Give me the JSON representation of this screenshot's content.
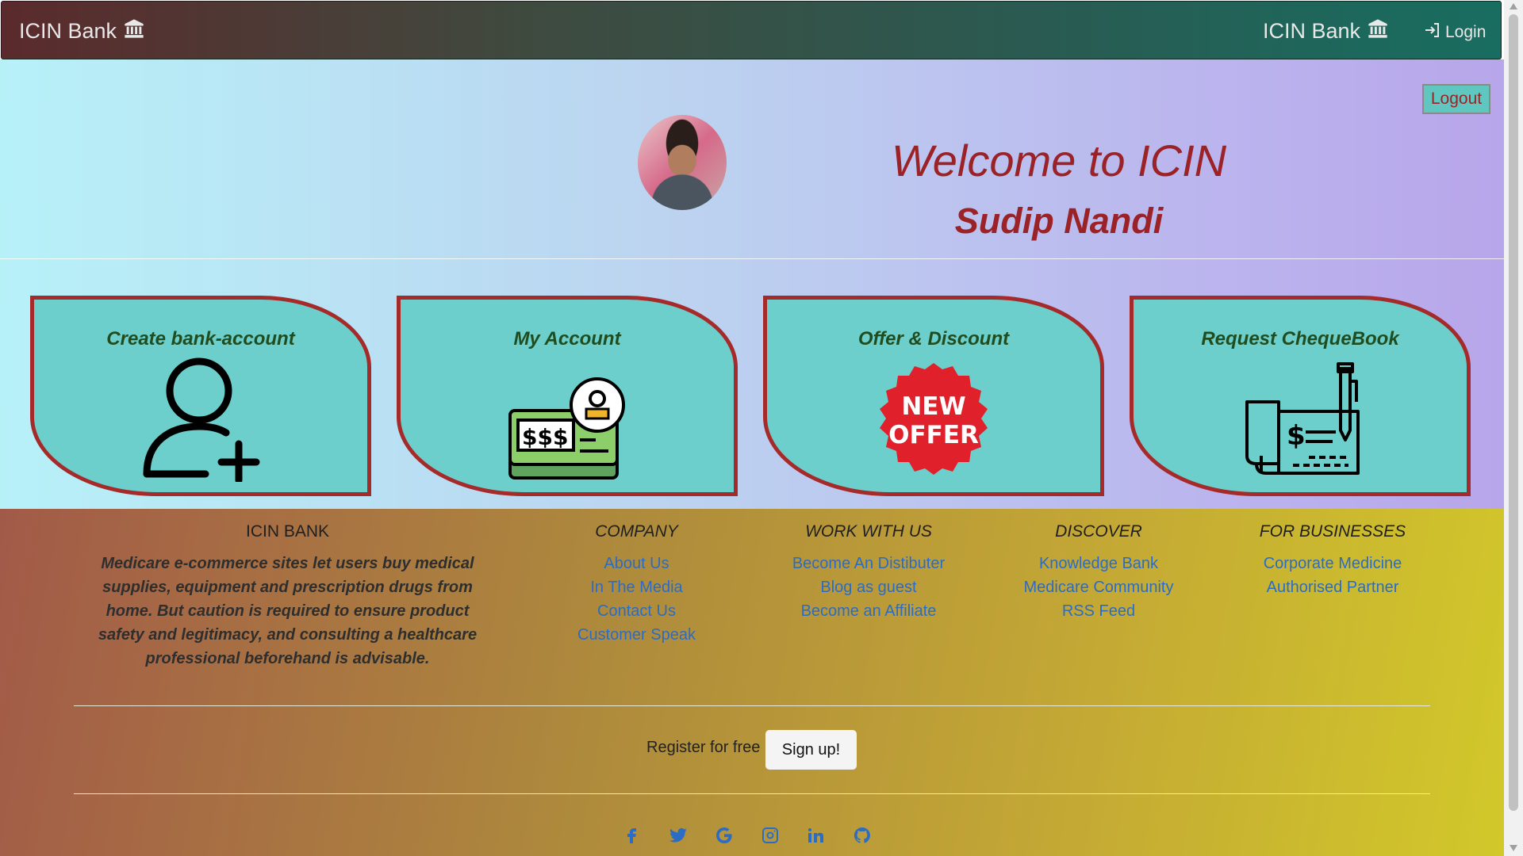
{
  "navbar": {
    "brand_left": "ICIN Bank",
    "brand_right": "ICIN Bank",
    "login_label": "Login"
  },
  "hero": {
    "logout_label": "Logout",
    "welcome": "Welcome to ICIN",
    "user_name": "Sudip Nandi"
  },
  "cards": [
    {
      "title": "Create bank-account",
      "icon": "add-user-icon"
    },
    {
      "title": "My Account",
      "icon": "account-cheque-icon"
    },
    {
      "title": "Offer & Discount",
      "icon": "new-offer-badge-icon",
      "badge_line1": "NEW",
      "badge_line2": "OFFER"
    },
    {
      "title": "Request ChequeBook",
      "icon": "chequebook-pen-icon"
    }
  ],
  "footer": {
    "about": {
      "title": "ICIN BANK",
      "text": "Medicare e-commerce sites let users buy medical supplies, equipment and prescription drugs from home. But caution is required to ensure product safety and legitimacy, and consulting a healthcare professional beforehand is advisable."
    },
    "columns": [
      {
        "title": "COMPANY",
        "links": [
          "About Us",
          "In The Media",
          "Contact Us",
          "Customer Speak"
        ]
      },
      {
        "title": "WORK WITH US",
        "links": [
          "Become An Distibuter",
          "Blog as guest",
          "Become an Affiliate"
        ]
      },
      {
        "title": "DISCOVER",
        "links": [
          "Knowledge Bank",
          "Medicare Community",
          "RSS Feed"
        ]
      },
      {
        "title": "FOR BUSINESSES",
        "links": [
          "Corporate Medicine",
          "Authorised Partner"
        ]
      }
    ],
    "register_text": "Register for free",
    "signup_label": "Sign up!",
    "socials": [
      "facebook-icon",
      "twitter-icon",
      "google-icon",
      "instagram-icon",
      "linkedin-icon",
      "github-icon"
    ]
  },
  "colors": {
    "accent_red": "#9b2226",
    "card_fill": "#6dcfcc",
    "card_border": "#a52a2a",
    "link_blue": "#2b6cc4"
  }
}
